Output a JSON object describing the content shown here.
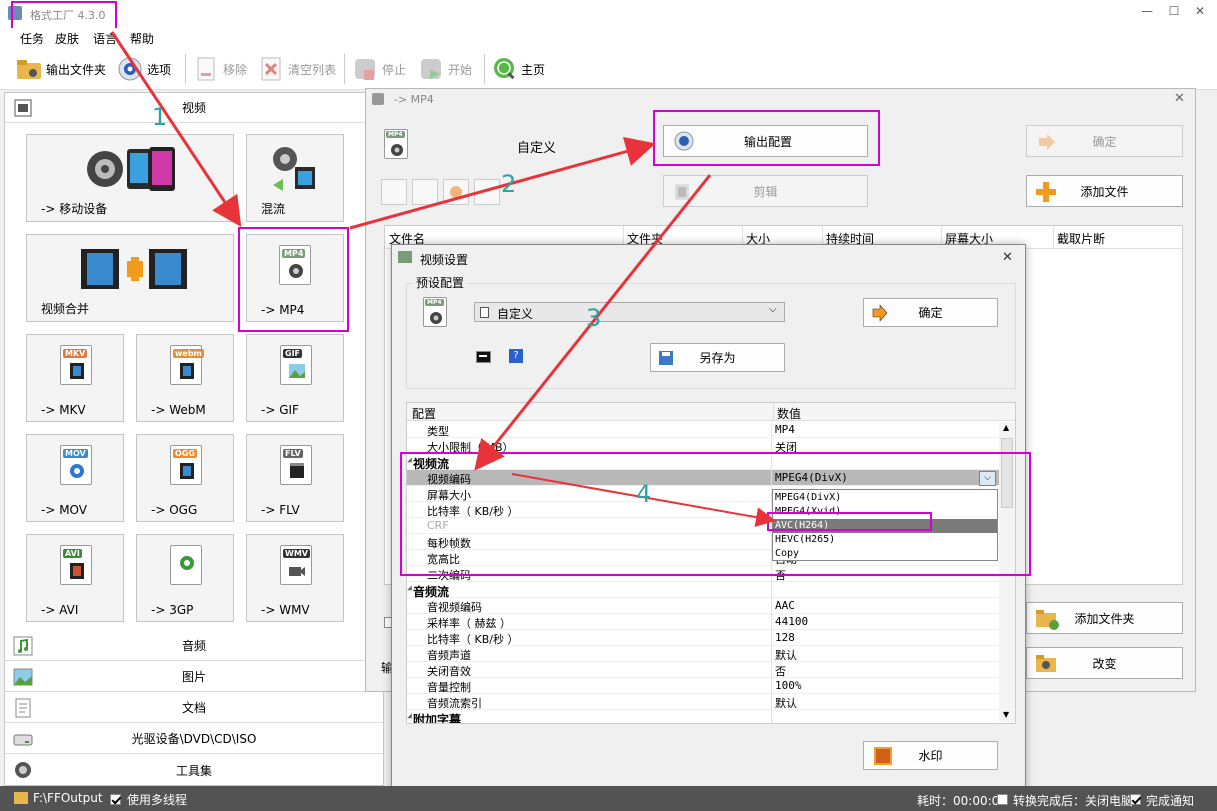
{
  "window": {
    "title": "格式工厂 4.3.0",
    "min": "—",
    "max": "☐",
    "close": "✕"
  },
  "menu": [
    "任务",
    "皮肤",
    "语言",
    "帮助"
  ],
  "toolbar": {
    "output_folder": "输出文件夹",
    "options": "选项",
    "remove": "移除",
    "clear": "清空列表",
    "stop": "停止",
    "start": "开始",
    "home": "主页"
  },
  "left": {
    "video_header": "视频",
    "tiles": {
      "mobile": "-> 移动设备",
      "mix": "混流",
      "merge": "视频合并",
      "mp4": "-> MP4",
      "mkv": "-> MKV",
      "webm": "-> WebM",
      "gif": "-> GIF",
      "mov": "-> MOV",
      "ogg": "-> OGG",
      "flv": "-> FLV",
      "avi": "-> AVI",
      "gp3": "-> 3GP",
      "wmv": "-> WMV"
    },
    "tags": {
      "mp4": "MP4",
      "mkv": "MKV",
      "webm": "webm",
      "gif": "GIF",
      "mov": "MOV",
      "ogg": "OGG",
      "flv": "FLV",
      "avi": "AVI",
      "wmv": "WMV"
    },
    "categories": {
      "audio": "音频",
      "image": "图片",
      "doc": "文档",
      "disc": "光驱设备\\DVD\\CD\\ISO",
      "tools": "工具集"
    }
  },
  "mp4dlg": {
    "title": "-> MP4",
    "profile": "自定义",
    "output_config": "输出配置",
    "ok": "确定",
    "clip": "剪辑",
    "add_file": "添加文件",
    "add_folder": "添加文件夹",
    "change": "改变",
    "output_lbl": "输",
    "columns": [
      "文件名",
      "文件夹",
      "大小",
      "持续时间",
      "屏幕大小",
      "截取片断"
    ]
  },
  "vsdlg": {
    "title": "视频设置",
    "preset_group": "预设配置",
    "preset_value": "自定义",
    "ok": "确定",
    "save_as": "另存为",
    "col_config": "配置",
    "col_value": "数值",
    "rows": [
      {
        "k": "类型",
        "v": "MP4"
      },
      {
        "k": "大小限制（ MB）",
        "v": "关闭"
      },
      {
        "k": "视频流",
        "v": "",
        "sec": true
      },
      {
        "k": "视频编码",
        "v": "MPEG4(DivX)"
      },
      {
        "k": "屏幕大小",
        "v": ""
      },
      {
        "k": "比特率（ KB/秒 ）",
        "v": ""
      },
      {
        "k": "CRF",
        "v": ""
      },
      {
        "k": "每秒帧数",
        "v": ""
      },
      {
        "k": "宽高比",
        "v": "自动"
      },
      {
        "k": "二次编码",
        "v": "否"
      },
      {
        "k": "音频流",
        "v": "",
        "sec": true
      },
      {
        "k": "音视频编码",
        "v": "AAC"
      },
      {
        "k": "采样率（ 赫兹 ）",
        "v": "44100"
      },
      {
        "k": "比特率（ KB/秒 ）",
        "v": "128"
      },
      {
        "k": "音频声道",
        "v": "默认"
      },
      {
        "k": "关闭音效",
        "v": "否"
      },
      {
        "k": "音量控制",
        "v": "100%"
      },
      {
        "k": "音频流索引",
        "v": "默认"
      },
      {
        "k": "附加字幕",
        "v": "",
        "sec": true
      }
    ],
    "dropdown": [
      "MPEG4(DivX)",
      "MPEG4(Xvid)",
      "AVC(H264)",
      "HEVC(H265)",
      "Copy"
    ],
    "dropdown_selected": "AVC(H264)",
    "watermark": "水印"
  },
  "annotations": [
    "1",
    "2",
    "3",
    "4"
  ],
  "status": {
    "path": "F:\\FFOutput",
    "multithread": "使用多线程",
    "elapsed": "耗时：00:00:00",
    "after": "转换完成后：关闭电脑",
    "notify": "完成通知"
  },
  "colors": {
    "highlight": "#d400d4",
    "arrow": "#e8333a",
    "number": "#2aa5a5",
    "dropdown_sel": "#7a7a7a"
  }
}
